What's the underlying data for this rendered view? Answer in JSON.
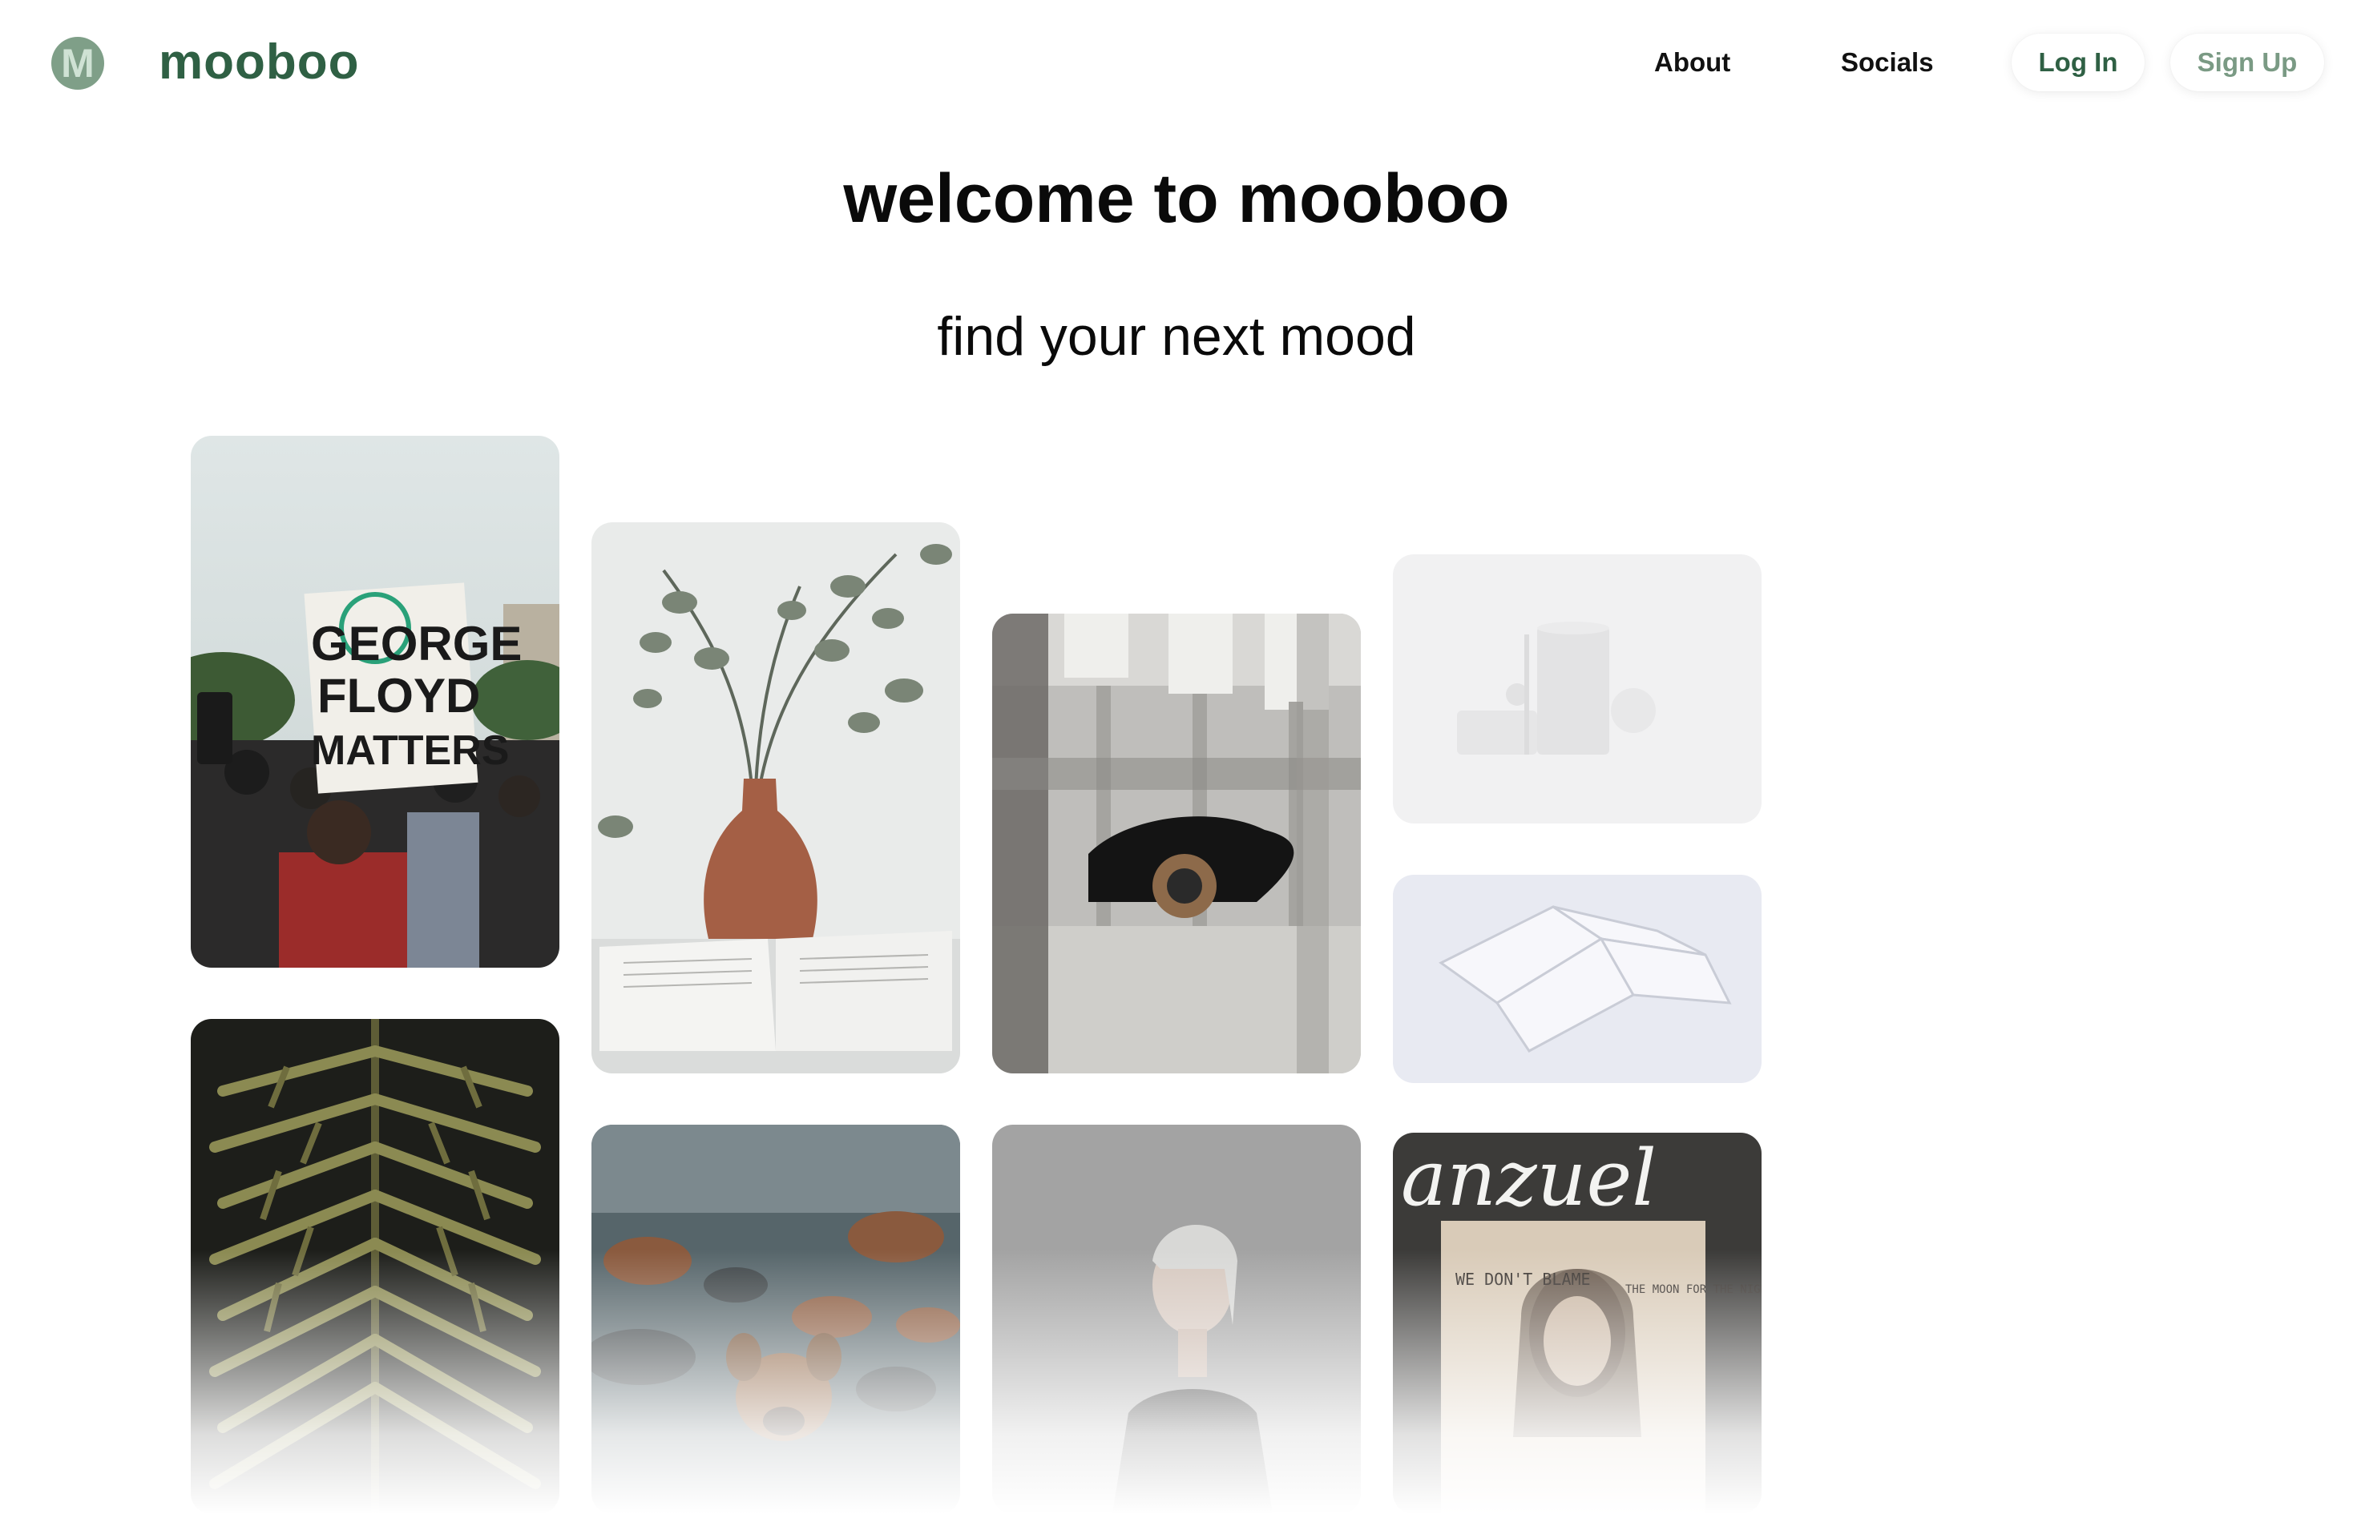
{
  "header": {
    "logo_letter": "M",
    "brand": "mooboo",
    "nav": {
      "about": "About",
      "socials": "Socials"
    },
    "login_label": "Log In",
    "signup_label": "Sign Up"
  },
  "hero": {
    "title": "welcome to mooboo",
    "subtitle": "find your next mood"
  },
  "gallery": {
    "protest_sign": {
      "line1": "GEORGE",
      "line2": "FLOYD",
      "line3": "MATTERS"
    },
    "graffiti": {
      "tag": "anzuel",
      "left_note": "WE DON'T BLAME",
      "right_note": "THE MOON FOR THE NIGHT"
    }
  },
  "colors": {
    "brand_green": "#2f6044",
    "brand_light": "#7a9a84",
    "logo_bg": "#7f9f88"
  }
}
